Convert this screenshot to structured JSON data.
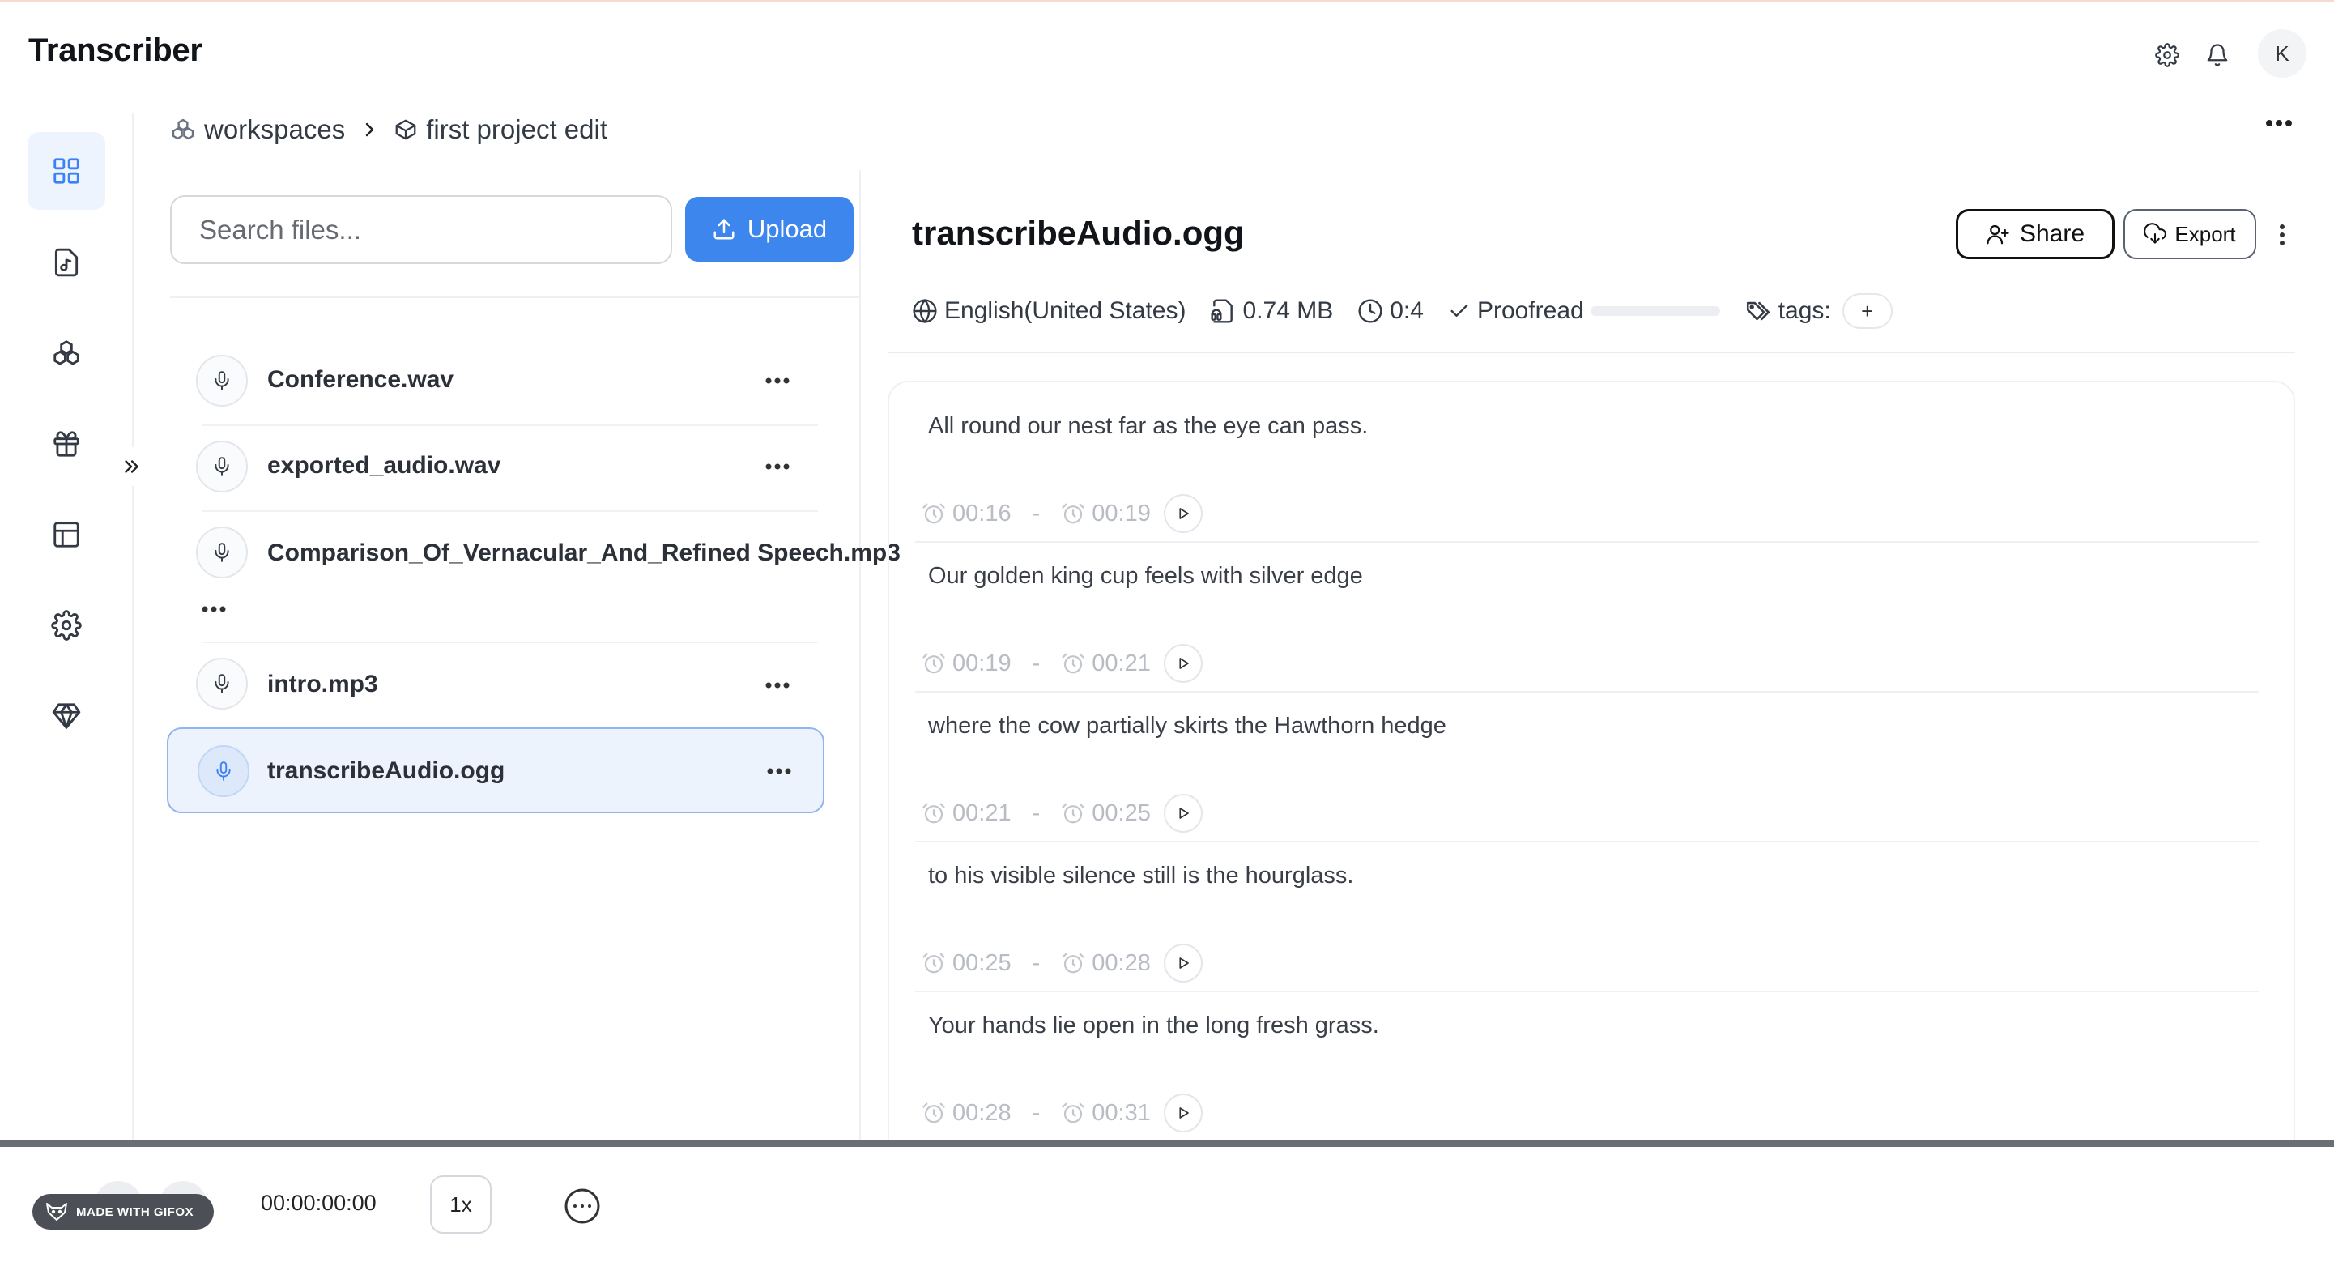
{
  "app": {
    "title": "Transcriber",
    "avatar_initial": "K"
  },
  "colors": {
    "accent": "#3c86ee",
    "selected_bg": "#edf3fd",
    "muted_time": "#b8bcc3"
  },
  "breadcrumb": {
    "items": [
      {
        "icon": "workspaces-icon",
        "label": "workspaces"
      },
      {
        "icon": "box-icon",
        "label": "first project edit"
      }
    ]
  },
  "sidebar": {
    "items": [
      "dashboard-grid-icon",
      "audio-file-icon",
      "workspaces-icon",
      "gift-icon",
      "layout-icon",
      "settings-icon",
      "diamond-icon"
    ],
    "active_index": 0
  },
  "files": {
    "search_placeholder": "Search files...",
    "upload_label": "Upload",
    "items": [
      {
        "name": "Conference.wav",
        "selected": false
      },
      {
        "name": "exported_audio.wav",
        "selected": false
      },
      {
        "name": "Comparison_Of_Vernacular_And_Refined Speech.mp3",
        "selected": false
      },
      {
        "name": "intro.mp3",
        "selected": false
      },
      {
        "name": "transcribeAudio.ogg",
        "selected": true
      }
    ]
  },
  "detail": {
    "title": "transcribeAudio.ogg",
    "share_label": "Share",
    "export_label": "Export",
    "language": "English(United States)",
    "size": "0.74 MB",
    "duration": "0:4",
    "proofread_label": "Proofread",
    "proofread_progress": 0,
    "tags_label": "tags:",
    "tag_add": "+"
  },
  "transcript": [
    {
      "text": "All round our nest far as the eye can pass.",
      "start": "00:16",
      "end": "00:19"
    },
    {
      "text": "Our golden king cup feels with silver edge",
      "start": "00:19",
      "end": "00:21"
    },
    {
      "text": "where the cow partially skirts the Hawthorn hedge",
      "start": "00:21",
      "end": "00:25"
    },
    {
      "text": "to his visible silence still is the hourglass.",
      "start": "00:25",
      "end": "00:28"
    },
    {
      "text": "Your hands lie open in the long fresh grass.",
      "start": "00:28",
      "end": "00:31"
    }
  ],
  "player": {
    "timecode": "00:00:00:00",
    "speed": "1x",
    "badge": "MADE WITH GIFOX"
  }
}
